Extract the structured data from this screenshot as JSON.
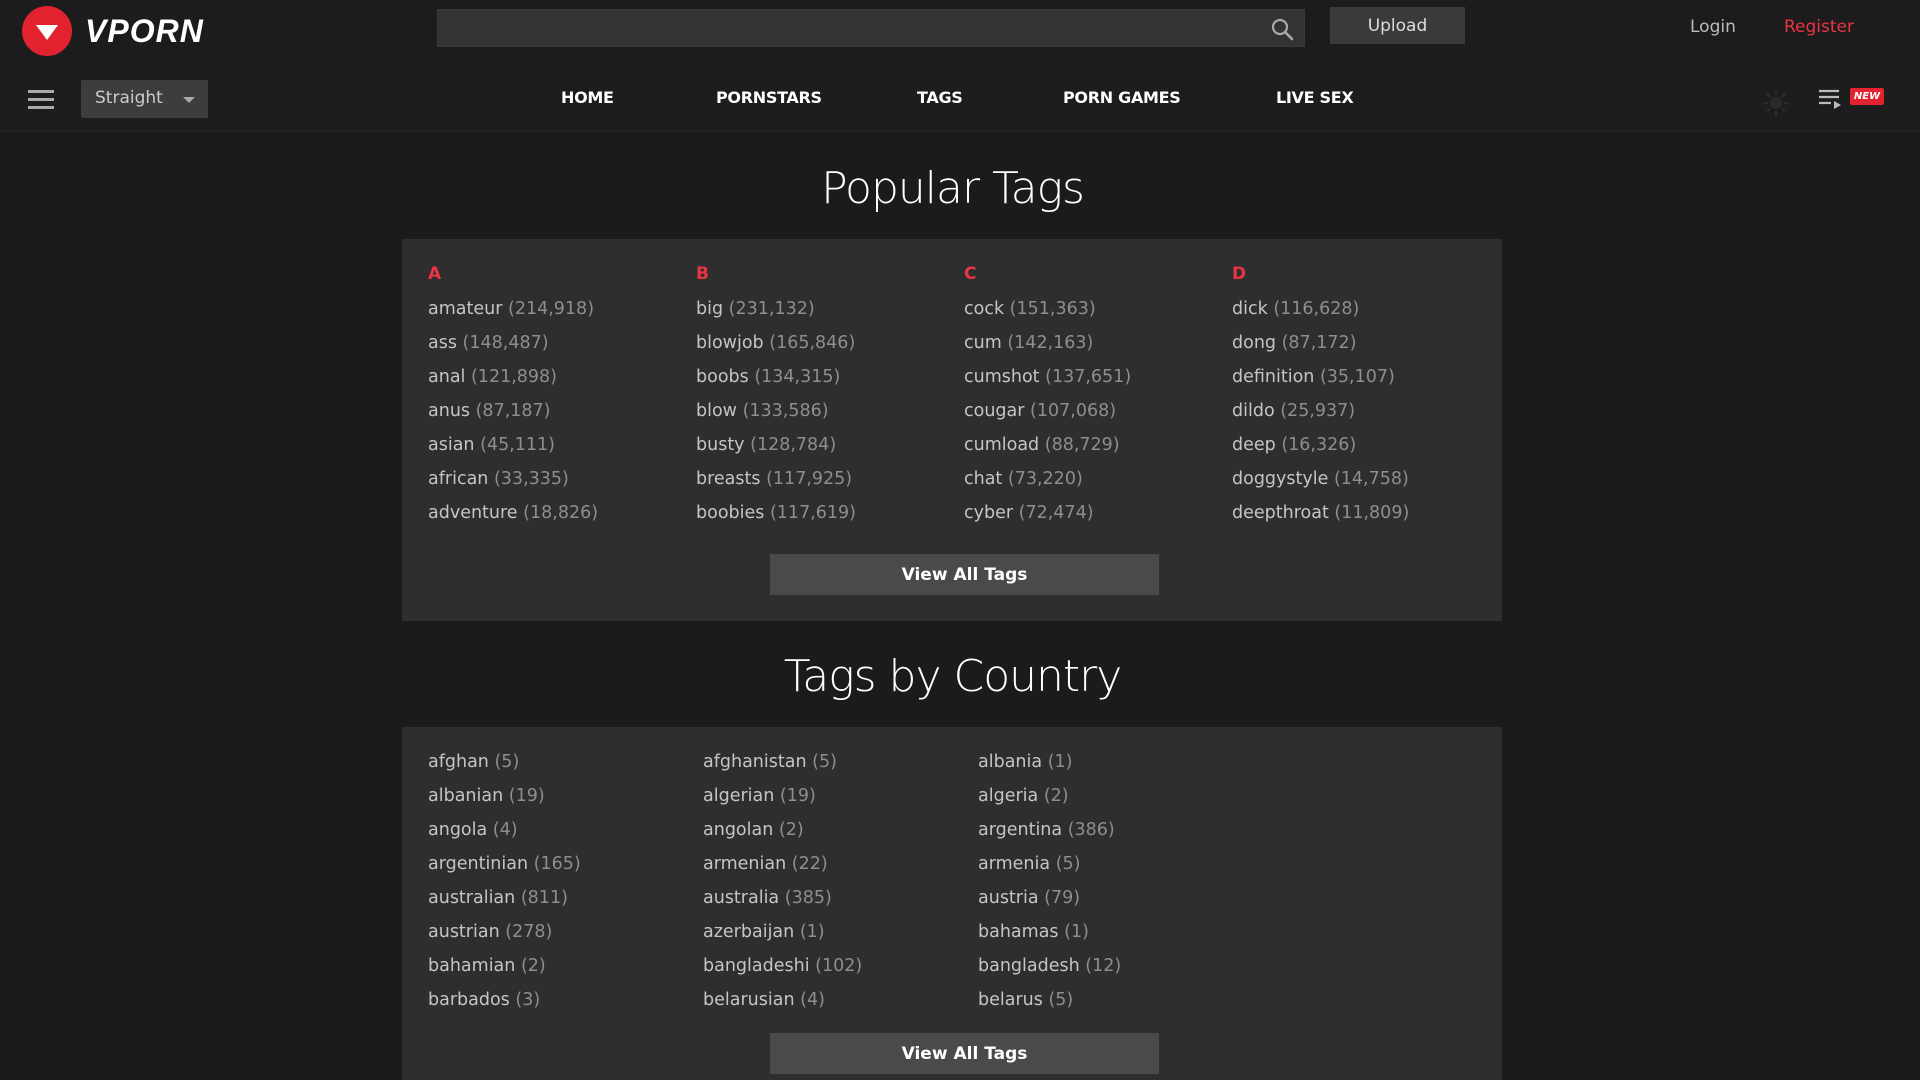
{
  "header": {
    "brand": "VPORN",
    "search_placeholder": "",
    "upload_label": "Upload",
    "login_label": "Login",
    "register_label": "Register",
    "brand_color": "#e3222f"
  },
  "nav": {
    "orientation": "Straight",
    "links": [
      "HOME",
      "PORNSTARS",
      "TAGS",
      "PORN GAMES",
      "LIVE SEX"
    ],
    "new_badge": "NEW"
  },
  "popular": {
    "title": "Popular Tags",
    "view_all": "View All Tags",
    "groups": [
      {
        "letter": "A",
        "tags": [
          {
            "name": "amateur",
            "count": "(214,918)"
          },
          {
            "name": "ass",
            "count": "(148,487)"
          },
          {
            "name": "anal",
            "count": "(121,898)"
          },
          {
            "name": "anus",
            "count": "(87,187)"
          },
          {
            "name": "asian",
            "count": "(45,111)"
          },
          {
            "name": "african",
            "count": "(33,335)"
          },
          {
            "name": "adventure",
            "count": "(18,826)"
          }
        ]
      },
      {
        "letter": "B",
        "tags": [
          {
            "name": "big",
            "count": "(231,132)"
          },
          {
            "name": "blowjob",
            "count": "(165,846)"
          },
          {
            "name": "boobs",
            "count": "(134,315)"
          },
          {
            "name": "blow",
            "count": "(133,586)"
          },
          {
            "name": "busty",
            "count": "(128,784)"
          },
          {
            "name": "breasts",
            "count": "(117,925)"
          },
          {
            "name": "boobies",
            "count": "(117,619)"
          }
        ]
      },
      {
        "letter": "C",
        "tags": [
          {
            "name": "cock",
            "count": "(151,363)"
          },
          {
            "name": "cum",
            "count": "(142,163)"
          },
          {
            "name": "cumshot",
            "count": "(137,651)"
          },
          {
            "name": "cougar",
            "count": "(107,068)"
          },
          {
            "name": "cumload",
            "count": "(88,729)"
          },
          {
            "name": "chat",
            "count": "(73,220)"
          },
          {
            "name": "cyber",
            "count": "(72,474)"
          }
        ]
      },
      {
        "letter": "D",
        "tags": [
          {
            "name": "dick",
            "count": "(116,628)"
          },
          {
            "name": "dong",
            "count": "(87,172)"
          },
          {
            "name": "definition",
            "count": "(35,107)"
          },
          {
            "name": "dildo",
            "count": "(25,937)"
          },
          {
            "name": "deep",
            "count": "(16,326)"
          },
          {
            "name": "doggystyle",
            "count": "(14,758)"
          },
          {
            "name": "deepthroat",
            "count": "(11,809)"
          }
        ]
      }
    ]
  },
  "country": {
    "title": "Tags by Country",
    "view_all": "View All Tags",
    "columns": [
      [
        {
          "name": "afghan",
          "count": "(5)"
        },
        {
          "name": "albanian",
          "count": "(19)"
        },
        {
          "name": "angola",
          "count": "(4)"
        },
        {
          "name": "argentinian",
          "count": "(165)"
        },
        {
          "name": "australian",
          "count": "(811)"
        },
        {
          "name": "austrian",
          "count": "(278)"
        },
        {
          "name": "bahamian",
          "count": "(2)"
        },
        {
          "name": "barbados",
          "count": "(3)"
        }
      ],
      [
        {
          "name": "afghanistan",
          "count": "(5)"
        },
        {
          "name": "algerian",
          "count": "(19)"
        },
        {
          "name": "angolan",
          "count": "(2)"
        },
        {
          "name": "armenian",
          "count": "(22)"
        },
        {
          "name": "australia",
          "count": "(385)"
        },
        {
          "name": "azerbaijan",
          "count": "(1)"
        },
        {
          "name": "bangladeshi",
          "count": "(102)"
        },
        {
          "name": "belarusian",
          "count": "(4)"
        }
      ],
      [
        {
          "name": "albania",
          "count": "(1)"
        },
        {
          "name": "algeria",
          "count": "(2)"
        },
        {
          "name": "argentina",
          "count": "(386)"
        },
        {
          "name": "armenia",
          "count": "(5)"
        },
        {
          "name": "austria",
          "count": "(79)"
        },
        {
          "name": "bahamas",
          "count": "(1)"
        },
        {
          "name": "bangladesh",
          "count": "(12)"
        },
        {
          "name": "belarus",
          "count": "(5)"
        }
      ]
    ]
  }
}
